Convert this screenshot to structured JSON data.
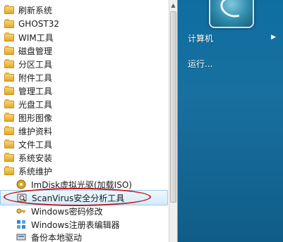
{
  "programs": [
    {
      "label": "刷新系统",
      "icon": "folder-icon"
    },
    {
      "label": "GHOST32",
      "icon": "folder-icon"
    },
    {
      "label": "WIM工具",
      "icon": "folder-icon"
    },
    {
      "label": "磁盘管理",
      "icon": "folder-icon"
    },
    {
      "label": "分区工具",
      "icon": "folder-icon"
    },
    {
      "label": "附件工具",
      "icon": "folder-icon"
    },
    {
      "label": "管理工具",
      "icon": "folder-icon"
    },
    {
      "label": "光盘工具",
      "icon": "folder-icon"
    },
    {
      "label": "图形图像",
      "icon": "folder-icon"
    },
    {
      "label": "维护资料",
      "icon": "folder-icon"
    },
    {
      "label": "文件工具",
      "icon": "folder-icon"
    },
    {
      "label": "系统安装",
      "icon": "folder-icon"
    },
    {
      "label": "系统维护",
      "icon": "folder-icon"
    }
  ],
  "sub_items": [
    {
      "label": "ImDisk虚拟光驱(加载ISO)",
      "icon": "disc-icon"
    },
    {
      "label": "ScanVirus安全分析工具",
      "icon": "scanvirus-icon"
    },
    {
      "label": "Windows密码修改",
      "icon": "key-icon"
    },
    {
      "label": "Windows注册表编辑器",
      "icon": "registry-icon"
    },
    {
      "label": "备份本地驱动",
      "icon": "backup-icon"
    }
  ],
  "right_panel": {
    "computer": "计算机",
    "run": "运行..."
  },
  "colors": {
    "highlight_oval": "#c0171c",
    "right_panel_bg": "#18709f"
  }
}
